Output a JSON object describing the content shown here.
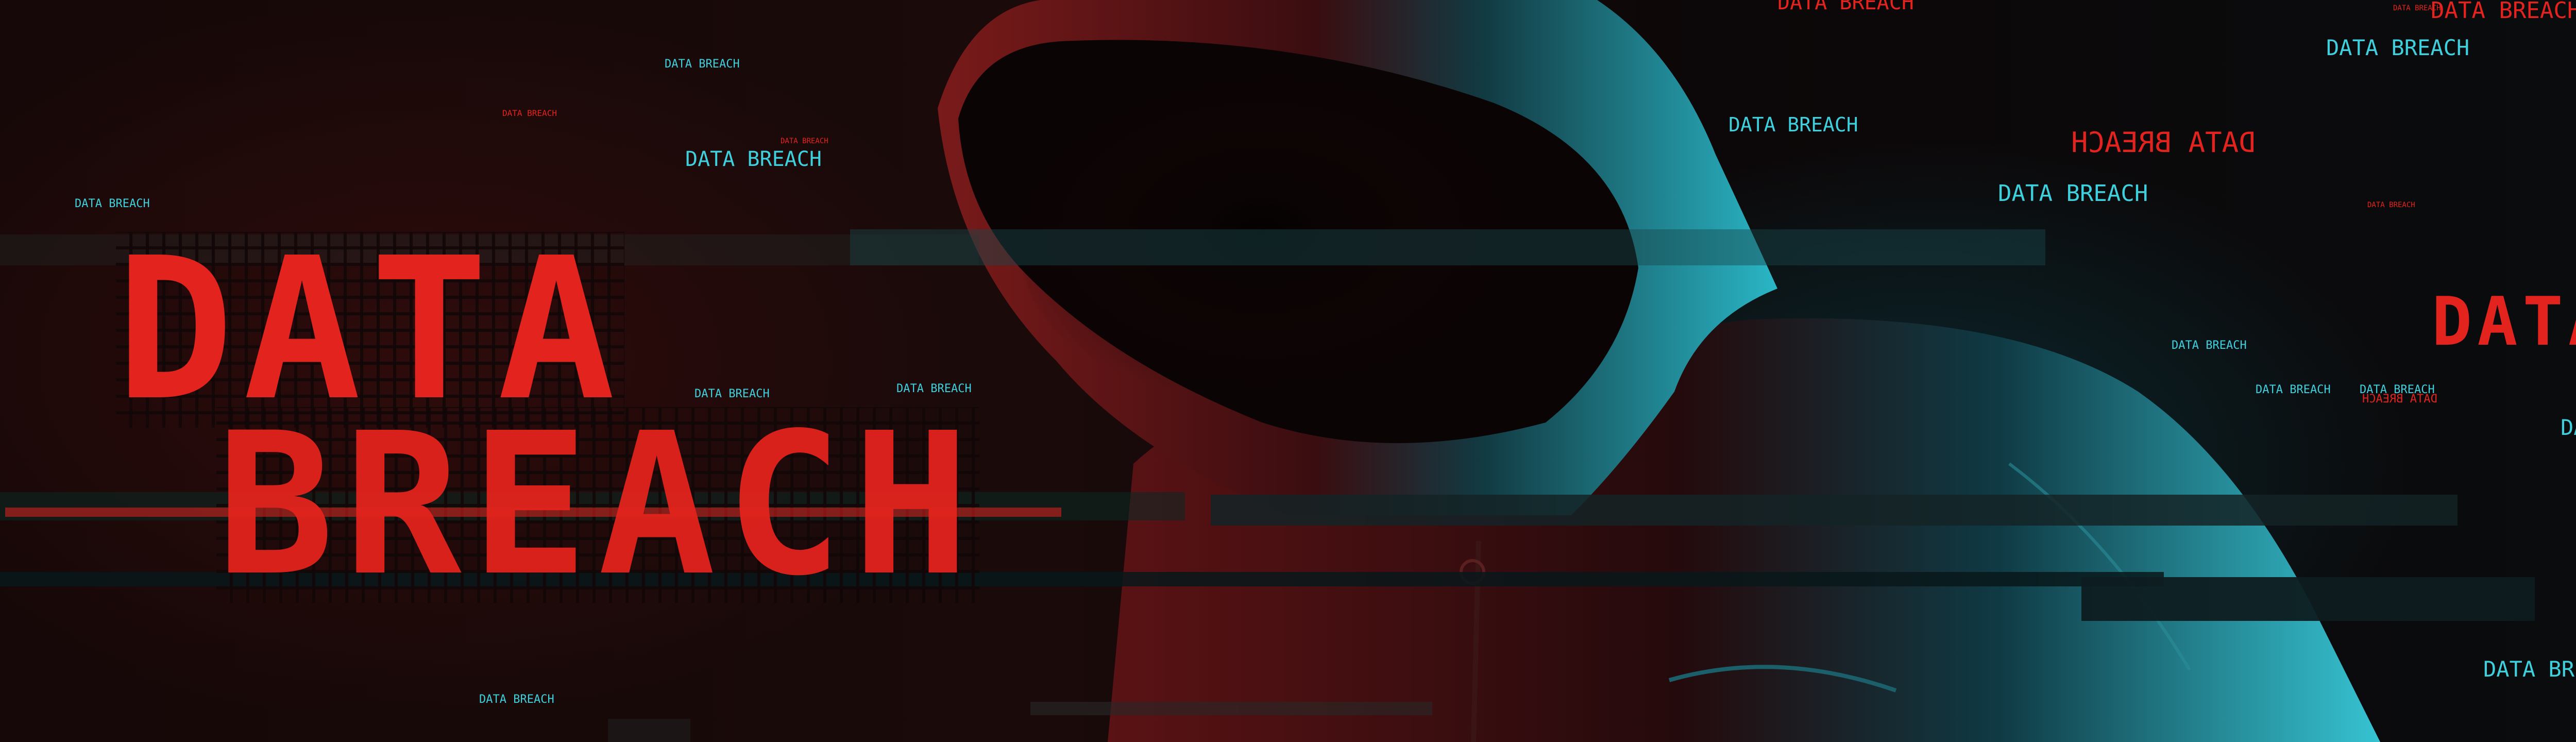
{
  "headline": {
    "line1": "DATA",
    "line2": "BREACH"
  },
  "right_headline": "DATA",
  "floating_labels": [
    "DATA BREACH",
    "DATA BREACH",
    "DATA BREACH",
    "DATA BREACH",
    "DATA BREACH",
    "DATA BREACH",
    "DATA BREACH",
    "DATA BREACH",
    "DATA BREACH",
    "DATA BREACH",
    "DATA BREACH",
    "DATA BREACH",
    "DATA BREACH",
    "DATA BREACH",
    "DATA BREACH",
    "DATA BREACH",
    "DATA BREACH",
    "DATA BREACH",
    "DATA BREACH",
    "DATA BREACH",
    "DATA BREACH",
    "DATA BREACH"
  ],
  "colors": {
    "red": "#e3231d",
    "cyan": "#3fd0de",
    "background": "#120708"
  }
}
